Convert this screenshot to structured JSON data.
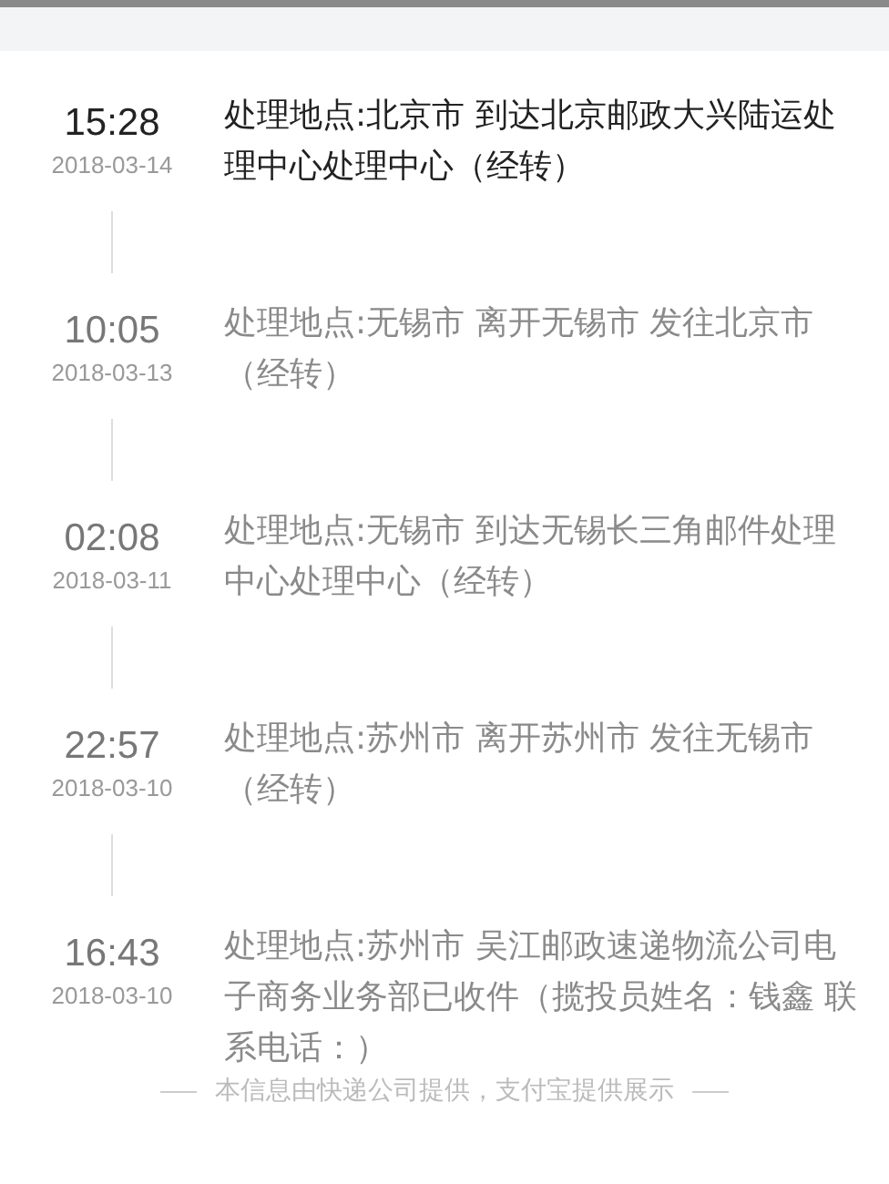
{
  "entries": [
    {
      "time": "15:28",
      "date": "2018-03-14",
      "text": "处理地点:北京市 到达北京邮政大兴陆运处理中心处理中心（经转）",
      "latest": true
    },
    {
      "time": "10:05",
      "date": "2018-03-13",
      "text": "处理地点:无锡市 离开无锡市 发往北京市（经转）",
      "latest": false
    },
    {
      "time": "02:08",
      "date": "2018-03-11",
      "text": "处理地点:无锡市 到达无锡长三角邮件处理中心处理中心（经转）",
      "latest": false
    },
    {
      "time": "22:57",
      "date": "2018-03-10",
      "text": "处理地点:苏州市 离开苏州市 发往无锡市（经转）",
      "latest": false
    },
    {
      "time": "16:43",
      "date": "2018-03-10",
      "text": "处理地点:苏州市 吴江邮政速递物流公司电子商务业务部已收件（揽投员姓名：钱鑫 联系电话：）",
      "latest": false
    }
  ],
  "footer": "本信息由快递公司提供，支付宝提供展示"
}
